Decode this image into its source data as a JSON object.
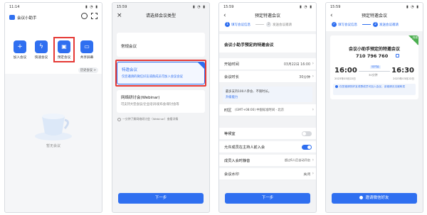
{
  "colors": {
    "accent": "#2f6ff0",
    "highlight": "#e53935",
    "green": "#4caf50",
    "orange": "#f5a623"
  },
  "screen1": {
    "time": "11:14",
    "status_icons": "▮ ◔ ▮",
    "app_title": "会议小助手",
    "header_icons": {
      "history": "history-icon",
      "scan": "scan-icon"
    },
    "actions": [
      {
        "label": "加入会议",
        "icon": "plus-icon",
        "color": "#2f6ff0"
      },
      {
        "label": "快速会议",
        "icon": "lightning-icon",
        "color": "#2f6ff0"
      },
      {
        "label": "预定会议",
        "icon": "calendar-icon",
        "color": "#2f6ff0"
      },
      {
        "label": "共享屏幕",
        "icon": "screen-share-icon",
        "color": "#2f6ff0"
      }
    ],
    "history_link": "历史会议 >",
    "empty_text": "暂无会议"
  },
  "screen2": {
    "time": "15:59",
    "title": "请选择会议类型",
    "options": [
      {
        "title": "常规会议",
        "desc": ""
      },
      {
        "title": "特邀会议",
        "desc": "仅您邀请的微信好友或群成员可加入会议会议"
      },
      {
        "title": "网络研讨会(Webinar)",
        "desc": "可支持大型会议/企业培训/发布会/研讨会等"
      }
    ],
    "link_text": "一分钟了解网络研讨会（Webinar）查看详情",
    "next_button": "下一步"
  },
  "screen3": {
    "time": "15:59",
    "title": "预定特邀会议",
    "steps": [
      {
        "num": "1",
        "label": "填写会议信息"
      },
      {
        "num": "2",
        "label": "发送会议邀请"
      }
    ],
    "meeting_name": "会议小助手预定的特邀会议",
    "start_label": "开始时间",
    "start_value": "03月22日 16:00",
    "duration_label": "会议时长",
    "duration_value": "30分钟",
    "notice_text": "最多支持100人参会、不限时长。",
    "notice_link": "升级能力",
    "timezone_label": "时区",
    "timezone_value": "(GMT+08:00) 中国标准时间 - 北京",
    "waiting_room_label": "等候室",
    "allow_join_label": "允许成员在主持人前入会",
    "mute_label": "成员入会时静音",
    "mute_value": "超过6人后自动开启",
    "watermark_label": "会议水印",
    "watermark_value": "关闭",
    "next_button": "下一步"
  },
  "screen4": {
    "time": "15:59",
    "title": "预定特邀会议",
    "steps": [
      {
        "num": "✓",
        "label": "填写会议信息"
      },
      {
        "num": "2",
        "label": "发送会议邀请"
      }
    ],
    "badge": "特邀",
    "meeting_name": "会议小助手预定的特邀会议",
    "meeting_id": "710 796 760",
    "start_time": "16:00",
    "end_time": "16:30",
    "start_date": "2023年03月22日",
    "end_date": "2023年03月22日",
    "status": "待开始",
    "duration": "30分钟",
    "notice_text": "仅您邀请的好友或群成员可加入会议，该邀请无法被转发",
    "invite_button": "邀请微信好友"
  }
}
